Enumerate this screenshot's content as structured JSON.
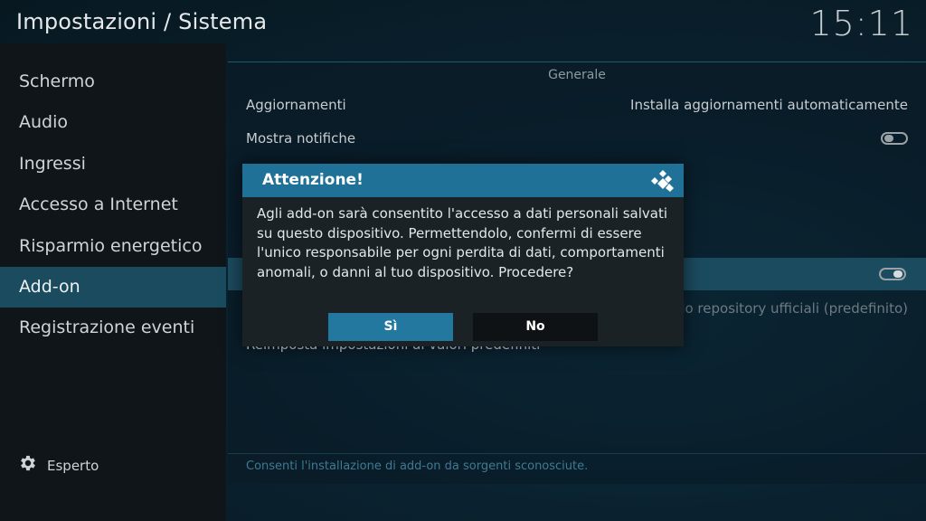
{
  "header": {
    "title": "Impostazioni / Sistema",
    "clock": "15:11"
  },
  "sidebar": {
    "items": [
      {
        "label": "Schermo"
      },
      {
        "label": "Audio"
      },
      {
        "label": "Ingressi"
      },
      {
        "label": "Accesso a Internet"
      },
      {
        "label": "Risparmio energetico"
      },
      {
        "label": "Add-on",
        "active": true
      },
      {
        "label": "Registrazione eventi"
      }
    ],
    "level_label": "Esperto",
    "level_icon": "gear-icon"
  },
  "panel": {
    "section": "Generale",
    "rows": [
      {
        "label": "Aggiornamenti",
        "value": "Installa aggiornamenti automaticamente"
      },
      {
        "label": "Mostra notifiche",
        "toggle": false
      },
      {
        "label": "",
        "toggle": true
      },
      {
        "label": "",
        "value": "Solo repository ufficiali (predefinito)"
      },
      {
        "label": "Reimposta impostazioni ai valori predefiniti"
      }
    ],
    "description": "Consenti l'installazione di add-on da sorgenti sconosciute."
  },
  "dialog": {
    "title": "Attenzione!",
    "icon": "kodi-logo-icon",
    "message": "Agli add-on sarà consentito l'accesso a dati personali salvati su questo dispositivo. Permettendolo, confermi di essere l'unico responsabile per ogni perdita di dati, comportamenti anomali, o danni al tuo dispositivo. Procedere?",
    "yes_label": "Sì",
    "no_label": "No"
  },
  "colors": {
    "accent": "#1f7197",
    "highlight": "#1b4b5e",
    "button_focus": "#2378a0"
  }
}
